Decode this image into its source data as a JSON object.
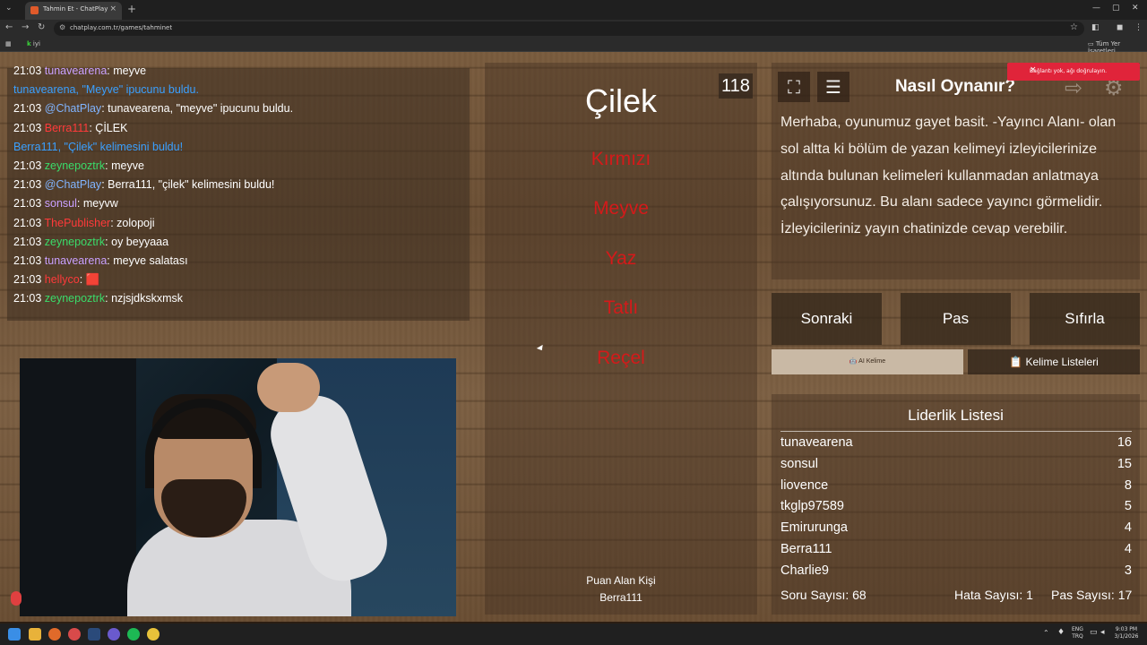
{
  "browser": {
    "tab_title": "Tahmin Et - ChatPlay",
    "url": "chatplay.com.tr/games/tahminet",
    "bookmark_label": "iyi",
    "all_bookmarks": "Tüm Yer İşaretleri"
  },
  "chat": {
    "messages": [
      {
        "time": "21:03",
        "user": "tunavearena",
        "text": ": meyve",
        "user_color": "#c9a0ff"
      },
      {
        "time": "",
        "user": "",
        "text": "tunavearena, \"Meyve\" ipucunu buldu.",
        "user_color": "#3aa0ff"
      },
      {
        "time": "21:03",
        "user": "@ChatPlay",
        "text": ": tunavearena, \"meyve\" ipucunu buldu.",
        "user_color": "#80b4ff"
      },
      {
        "time": "21:03",
        "user": "Berra111",
        "text": ": ÇİLEK",
        "user_color": "#ff3a3a"
      },
      {
        "time": "",
        "user": "",
        "text": "Berra111, \"Çilek\" kelimesini buldu!",
        "user_color": "#3aa0ff"
      },
      {
        "time": "21:03",
        "user": "zeynepoztrk",
        "text": ": meyve",
        "user_color": "#3adb6a"
      },
      {
        "time": "21:03",
        "user": "@ChatPlay",
        "text": ": Berra111, \"çilek\" kelimesini buldu!",
        "user_color": "#80b4ff"
      },
      {
        "time": "21:03",
        "user": "sonsul",
        "text": ": meyvw",
        "user_color": "#c9a0ff"
      },
      {
        "time": "21:03",
        "user": "ThePublisher",
        "text": ": zolopoji",
        "user_color": "#ff3a3a"
      },
      {
        "time": "21:03",
        "user": "zeynepoztrk",
        "text": ": oy beyyaaa",
        "user_color": "#3adb6a"
      },
      {
        "time": "21:03",
        "user": "tunavearena",
        "text": ": meyve salatası",
        "user_color": "#c9a0ff"
      },
      {
        "time": "21:03",
        "user": "hellyco",
        "text": ": 🟥",
        "user_color": "#ff3a3a"
      },
      {
        "time": "21:03",
        "user": "zeynepoztrk",
        "text": ": nzjsjdkskxmsk",
        "user_color": "#3adb6a"
      }
    ]
  },
  "game": {
    "word": "Çilek",
    "counter": "118",
    "taboo_words": [
      "Kırmızı",
      "Meyve",
      "Yaz",
      "Tatlı",
      "Reçel"
    ],
    "scorer_label": "Puan Alan Kişi",
    "scorer_name": "Berra111"
  },
  "howto": {
    "title": "Nasıl Oynanır?",
    "text": "Merhaba, oyunumuz gayet basit. -Yayıncı Alanı- olan sol altta ki bölüm de yazan kelimeyi izleyicilerinize altında bulunan kelimeleri kullanmadan anlatmaya çalışıyorsunuz. Bu alanı sadece yayıncı görmelidir. İzleyicileriniz yayın chatinizde cevap verebilir.",
    "toast": "Bağlantı yok, ağı doğrulayın."
  },
  "actions": {
    "next": "Sonraki",
    "pass": "Pas",
    "reset": "Sıfırla",
    "ai_words": "🤖 AI Kelime",
    "word_lists": "📋 Kelime Listeleri"
  },
  "leaderboard": {
    "title": "Liderlik Listesi",
    "rows": [
      {
        "name": "tunavearena",
        "score": "16"
      },
      {
        "name": "sonsul",
        "score": "15"
      },
      {
        "name": "liovence",
        "score": "8"
      },
      {
        "name": "tkglp97589",
        "score": "5"
      },
      {
        "name": "Emirurunga",
        "score": "4"
      },
      {
        "name": "Berra111",
        "score": "4"
      },
      {
        "name": "Charlie9",
        "score": "3"
      }
    ],
    "question_count": "Soru Sayısı: 68",
    "error_count": "Hata Sayısı: 1",
    "pass_count": "Pas Sayısı: 17"
  },
  "taskbar": {
    "lang": "ENG",
    "lang2": "TRQ",
    "time": "9:03 PM",
    "date": "3/1/2026"
  },
  "colors": {
    "taboo": "#d41a1a",
    "toast": "#e0243a"
  }
}
